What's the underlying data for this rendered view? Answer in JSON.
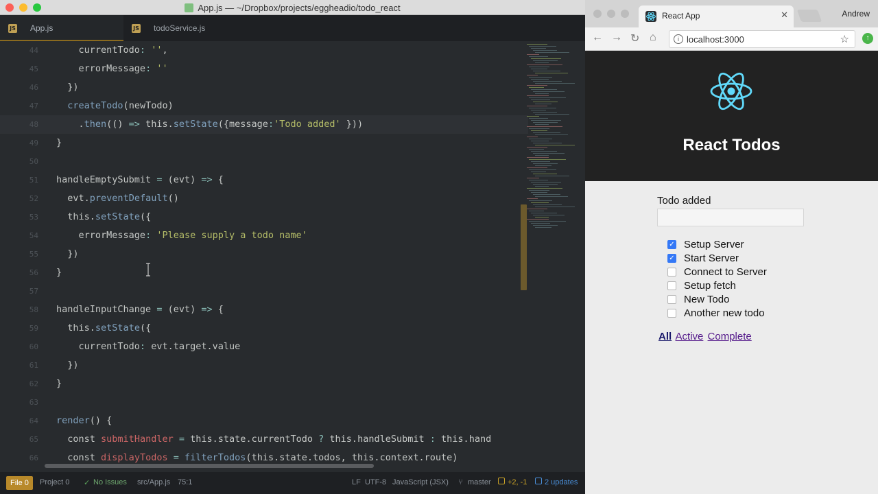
{
  "window": {
    "title": "App.js — ~/Dropbox/projects/eggheadio/todo_react"
  },
  "editor_tabs": [
    {
      "label": "App.js",
      "icon": "js-file-icon"
    },
    {
      "label": "todoService.js",
      "icon": "js-file-icon"
    }
  ],
  "code_lines": [
    {
      "num": "44",
      "html": "    currentTodo: '',"
    },
    {
      "num": "45",
      "html": "    errorMessage: ''"
    },
    {
      "num": "46",
      "html": "  })"
    },
    {
      "num": "47",
      "html": "  createTodo(newTodo)"
    },
    {
      "num": "48",
      "html": "    .then(() => this.setState({message:'Todo added' }))"
    },
    {
      "num": "49",
      "html": "}"
    },
    {
      "num": "50",
      "html": ""
    },
    {
      "num": "51",
      "html": "handleEmptySubmit = (evt) => {"
    },
    {
      "num": "52",
      "html": "  evt.preventDefault()"
    },
    {
      "num": "53",
      "html": "  this.setState({"
    },
    {
      "num": "54",
      "html": "    errorMessage: 'Please supply a todo name'"
    },
    {
      "num": "55",
      "html": "  })"
    },
    {
      "num": "56",
      "html": "}"
    },
    {
      "num": "57",
      "html": ""
    },
    {
      "num": "58",
      "html": "handleInputChange = (evt) => {"
    },
    {
      "num": "59",
      "html": "  this.setState({"
    },
    {
      "num": "60",
      "html": "    currentTodo: evt.target.value"
    },
    {
      "num": "61",
      "html": "  })"
    },
    {
      "num": "62",
      "html": "}"
    },
    {
      "num": "63",
      "html": ""
    },
    {
      "num": "64",
      "html": "render() {"
    },
    {
      "num": "65",
      "html": "  const submitHandler = this.state.currentTodo ? this.handleSubmit : this.hand"
    },
    {
      "num": "66",
      "html": "  const displayTodos = filterTodos(this.state.todos, this.context.route)"
    }
  ],
  "status": {
    "file": "File 0",
    "project": "Project 0",
    "issues": "No Issues",
    "path": "src/App.js",
    "cursor": "75:1",
    "line_ending": "LF",
    "encoding": "UTF-8",
    "grammar": "JavaScript (JSX)",
    "branch": "master",
    "diff": "+2, -1",
    "updates": "2 updates"
  },
  "browser": {
    "tab_title": "React App",
    "profile": "Andrew",
    "url": "localhost:3000"
  },
  "app": {
    "title": "React Todos",
    "message": "Todo added",
    "todos": [
      {
        "name": "Setup Server",
        "done": true
      },
      {
        "name": "Start Server",
        "done": true
      },
      {
        "name": "Connect to Server",
        "done": false
      },
      {
        "name": "Setup fetch",
        "done": false
      },
      {
        "name": "New Todo",
        "done": false
      },
      {
        "name": "Another new todo",
        "done": false
      }
    ],
    "filters": [
      "All",
      "Active",
      "Complete"
    ]
  },
  "colors": {
    "react_blue": "#61dafb",
    "checkbox_blue": "#3478f6",
    "link_purple": "#551a8b"
  }
}
